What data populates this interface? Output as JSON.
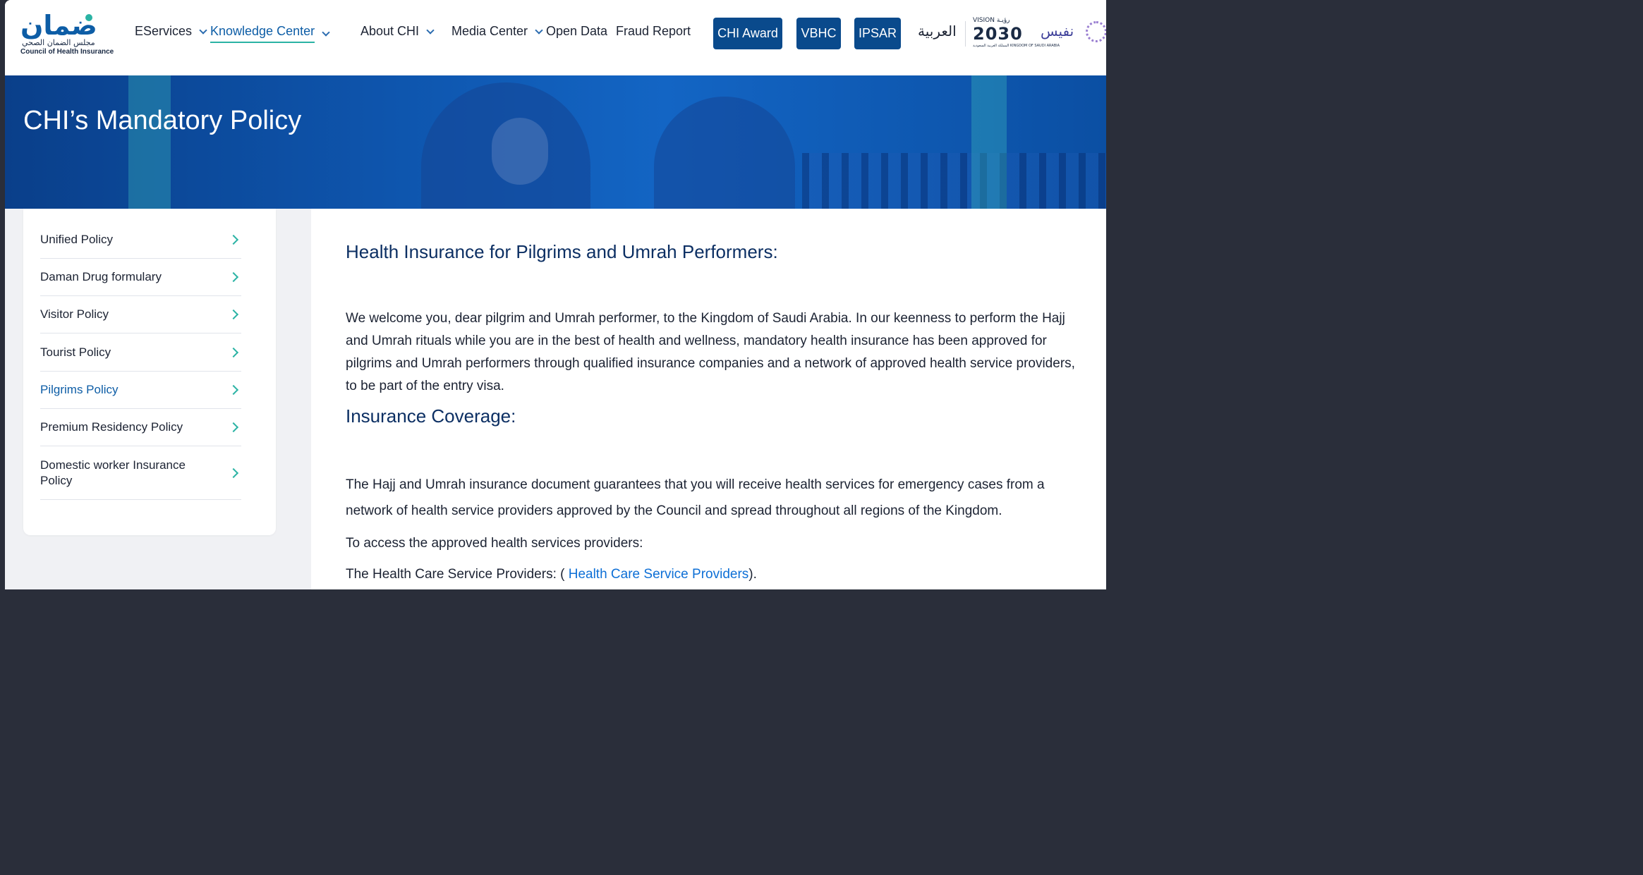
{
  "logo": {
    "arabic_mark": "ضمان",
    "arabic_name": "مجلس الضمان الصحي",
    "english_name": "Council of Health Insurance"
  },
  "nav": {
    "items": [
      {
        "label": "EServices",
        "has_dropdown": true
      },
      {
        "label": "Knowledge Center",
        "has_dropdown": true,
        "active": true
      },
      {
        "label": "About CHI",
        "has_dropdown": true
      },
      {
        "label": "Media Center",
        "has_dropdown": true
      },
      {
        "label": "Open Data",
        "has_dropdown": false
      },
      {
        "label": "Fraud Report",
        "has_dropdown": false
      }
    ],
    "buttons": [
      "CHI Award",
      "VBHC",
      "IPSAR"
    ],
    "language_switch": "العربية",
    "vision_top": "VISION رؤيـة",
    "vision_num": "2030",
    "vision_sub": "المملكة العربية السعودية KINGDOM OF SAUDI ARABIA",
    "nafees_label": "نفيس"
  },
  "hero": {
    "title": "CHI’s Mandatory Policy"
  },
  "sidebar": {
    "items": [
      {
        "label": "Unified Policy",
        "active": false
      },
      {
        "label": "Daman Drug formulary",
        "active": false
      },
      {
        "label": "Visitor Policy",
        "active": false
      },
      {
        "label": "Tourist Policy",
        "active": false
      },
      {
        "label": "Pilgrims Policy",
        "active": true
      },
      {
        "label": "Premium Residency Policy",
        "active": false
      },
      {
        "label": "Domestic worker Insurance Policy",
        "active": false
      }
    ]
  },
  "main": {
    "heading1": "Health Insurance for Pilgrims and Umrah Performers:",
    "paragraph1": "We welcome you, dear pilgrim and Umrah performer, to the Kingdom of Saudi Arabia. In our keenness to perform the Hajj and Umrah rituals while you are in the best of health and wellness, mandatory health insurance has been approved for pilgrims and Umrah performers through qualified insurance companies and a network of approved health service providers, to be part of the entry visa.",
    "heading2": "Insurance Coverage:",
    "paragraph2": "The Hajj and Umrah insurance document guarantees that you will receive health services for emergency cases from a network of health service providers approved by the Council and spread throughout all regions of the Kingdom.",
    "paragraph3": "To access the approved health services providers:",
    "paragraph4_prefix": "The Health Care Service Providers: ( ",
    "paragraph4_link": "Health Care Service Providers",
    "paragraph4_suffix": ")."
  },
  "colors": {
    "brand_blue": "#0a4a8c",
    "accent_teal": "#2bb3a4",
    "link_blue": "#0d6fd6",
    "heading_navy": "#0c2f63"
  }
}
